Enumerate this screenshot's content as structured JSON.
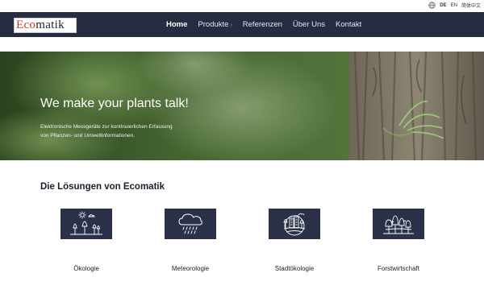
{
  "languages": {
    "items": [
      "DE",
      "EN",
      "简体中文"
    ],
    "active": "DE"
  },
  "logo": {
    "part1": "Eco",
    "part2": "matik"
  },
  "nav": {
    "items": [
      {
        "label": "Home",
        "active": true,
        "has_submenu": false
      },
      {
        "label": "Produkte",
        "active": false,
        "has_submenu": true
      },
      {
        "label": "Referenzen",
        "active": false,
        "has_submenu": false
      },
      {
        "label": "Über Uns",
        "active": false,
        "has_submenu": false
      },
      {
        "label": "Kontakt",
        "active": false,
        "has_submenu": false
      }
    ]
  },
  "hero": {
    "title": "We make your plants talk!",
    "subtitle_line1": "Elektronische Messgeräte zur kontinuierlichen Erfassung",
    "subtitle_line2": "von Pflanzen- und Umweltinformationen."
  },
  "solutions": {
    "title": "Die Lösungen von Ecomatik",
    "items": [
      {
        "label": "Ökologie",
        "icon": "ecology-icon"
      },
      {
        "label": "Meteorologie",
        "icon": "meteorology-icon"
      },
      {
        "label": "Stadtökologie",
        "icon": "urban-ecology-icon"
      },
      {
        "label": "Forstwirtschaft",
        "icon": "forestry-icon"
      }
    ]
  },
  "colors": {
    "navbar": "#262d43",
    "card": "#2a3148",
    "logo_accent": "#c0392b"
  }
}
